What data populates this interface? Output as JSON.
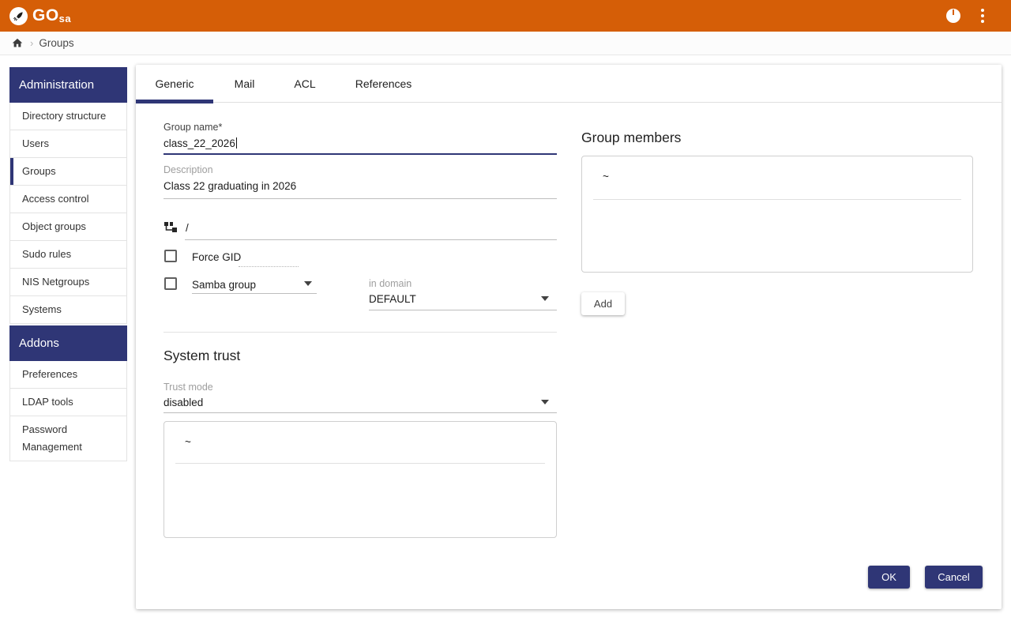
{
  "app": {
    "brand": "GO",
    "brand_suffix": "sa",
    "header_color": "#D55E07",
    "accent_color": "#2F3676"
  },
  "breadcrumb": {
    "separator": "›",
    "current": "Groups"
  },
  "sidebar": {
    "sections": [
      {
        "title": "Administration",
        "items": [
          {
            "label": "Directory structure"
          },
          {
            "label": "Users"
          },
          {
            "label": "Groups",
            "active": true
          },
          {
            "label": "Access control"
          },
          {
            "label": "Object groups"
          },
          {
            "label": "Sudo rules"
          },
          {
            "label": "NIS Netgroups"
          },
          {
            "label": "Systems"
          }
        ]
      },
      {
        "title": "Addons",
        "items": [
          {
            "label": "Preferences"
          },
          {
            "label": "LDAP tools"
          },
          {
            "label": "Password Management"
          }
        ]
      }
    ]
  },
  "tabs": {
    "active": "Generic",
    "items": [
      "Generic",
      "Mail",
      "ACL",
      "References"
    ]
  },
  "form": {
    "group_name": {
      "label": "Group name*",
      "value": "class_22_2026"
    },
    "description": {
      "label": "Description",
      "value": "Class 22 graduating in 2026"
    },
    "base": {
      "value": "/"
    },
    "force_gid": {
      "label": "Force GID",
      "checked": false
    },
    "samba_group": {
      "label": "Samba group",
      "checked": false
    },
    "in_domain": {
      "label": "in domain",
      "value": "DEFAULT"
    },
    "system_trust": {
      "title": "System trust",
      "trust_mode_label": "Trust mode",
      "trust_mode_value": "disabled",
      "list_placeholder": "~"
    },
    "members": {
      "title": "Group members",
      "list_placeholder": "~",
      "add_label": "Add"
    }
  },
  "actions": {
    "ok": "OK",
    "cancel": "Cancel"
  }
}
